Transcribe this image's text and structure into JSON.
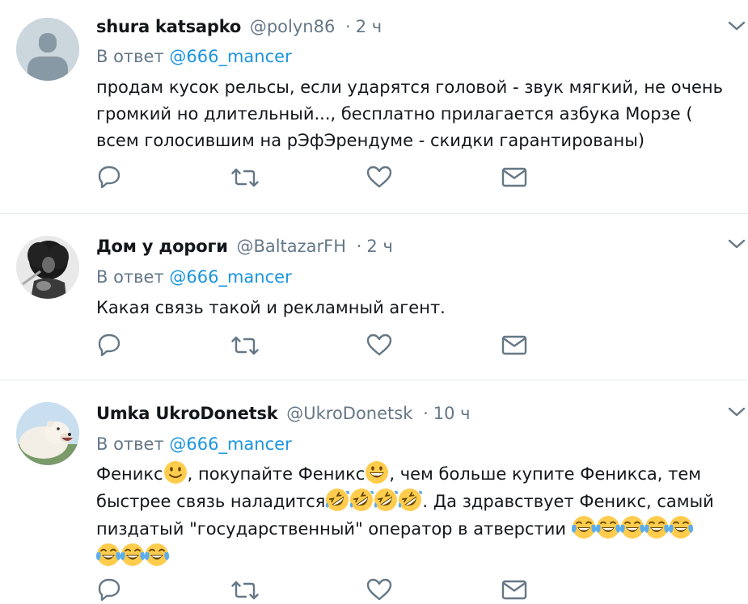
{
  "tweets": [
    {
      "name": "shura katsapko",
      "handle": "@polyn86",
      "separator": "·",
      "time": "2 ч",
      "reply_prefix": "В ответ",
      "reply_mention": "@666_mancer",
      "text": "продам кусок рельсы, если ударятся головой - звук мягкий, не очень\nгромкий но длительный..., бесплатно прилагается азбука Морзе (\nвсем голосившим на рЭфЭрендуме - скидки гарантированы)",
      "avatar": "default-avatar"
    },
    {
      "name": "Дом у дороги",
      "handle": "@BaltazarFH",
      "separator": "·",
      "time": "2 ч",
      "reply_prefix": "В ответ",
      "reply_mention": "@666_mancer",
      "text": "Какая связь такой и рекламный агент.",
      "avatar": "guitarist-photo"
    },
    {
      "name": "Umka UkroDonetsk",
      "handle": "@UkroDonetsk",
      "separator": "·",
      "time": "10 ч",
      "reply_prefix": "В ответ",
      "reply_mention": "@666_mancer",
      "text_parts": [
        "Феникс",
        ", покупайте Феникс",
        ", чем больше купите Феникса, тем",
        "быстрее связь наладится",
        ". Да здравствует Феникс, самый",
        "пиздатый \"государственный\" оператор в атверстии "
      ],
      "emoji": [
        "slightly-smiling-face",
        "grinning-face",
        "rolling-on-floor-laughing",
        "face-with-tears-of-joy"
      ],
      "avatar": "polar-bear-photo"
    }
  ],
  "icons": {
    "reply": "reply-icon",
    "retweet": "retweet-icon",
    "like": "heart-icon",
    "dm": "envelope-icon",
    "menu": "chevron-down-icon"
  },
  "colors": {
    "text": "#14171a",
    "muted": "#657786",
    "link": "#1b95e0",
    "divider": "#e6ecf0"
  }
}
